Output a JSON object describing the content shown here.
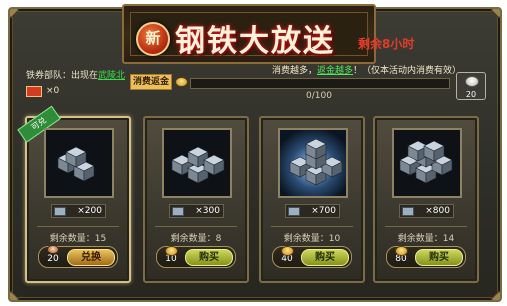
{
  "header": {
    "badge": "新",
    "title": "钢铁大放送",
    "time_left": "剩余8小时"
  },
  "info": {
    "merchant_prefix": "铁券部队：出现在",
    "merchant_location": "武陵北",
    "coupon_count": "×0"
  },
  "rebate": {
    "label": "消费返金",
    "tip_prefix": "消费越多，",
    "tip_highlight": "返金越多",
    "tip_suffix": "！（仅本活动内消费有效）",
    "progress_text": "0/100",
    "progress_fraction": 0,
    "reward_count": "20"
  },
  "cards": [
    {
      "tag": "可兑",
      "ore_amount": "×200",
      "remaining": "剩余数量：15",
      "cost": "20",
      "button": "兑换",
      "button_type": "redeem",
      "cost_icon": "coupon-cap-icon"
    },
    {
      "ore_amount": "×300",
      "remaining": "剩余数量：8",
      "cost": "10",
      "button": "购买",
      "button_type": "buy",
      "cost_icon": "gold-ingot-icon"
    },
    {
      "ore_amount": "×700",
      "remaining": "剩余数量：10",
      "cost": "40",
      "button": "购买",
      "button_type": "buy",
      "cost_icon": "gold-ingot-icon"
    },
    {
      "ore_amount": "×800",
      "remaining": "剩余数量：14",
      "cost": "80",
      "button": "购买",
      "button_type": "buy",
      "cost_icon": "gold-ingot-icon"
    }
  ]
}
